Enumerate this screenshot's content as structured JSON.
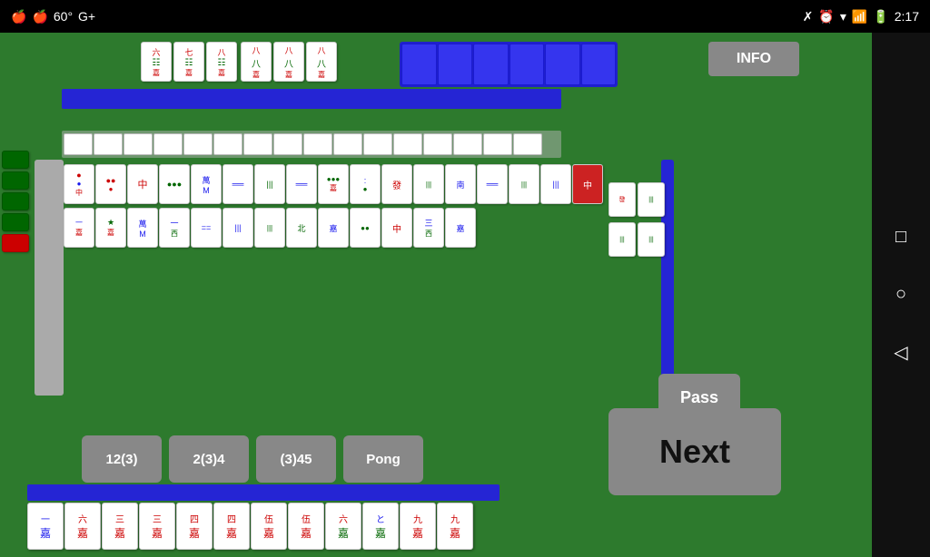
{
  "statusBar": {
    "leftIcons": [
      "🍎",
      "🍎"
    ],
    "temp": "60°",
    "gplus": "G+",
    "time": "2:17",
    "rightIcons": [
      "bluetooth",
      "alarm",
      "signal",
      "bars",
      "battery"
    ]
  },
  "gameArea": {
    "infoButton": "INFO",
    "passButton": "Pass",
    "nextButton": "Next",
    "actionButtons": [
      "12(3)",
      "2(3)4",
      "(3)45",
      "Pong"
    ]
  },
  "navBar": {
    "icons": [
      "□",
      "○",
      "◁"
    ]
  }
}
